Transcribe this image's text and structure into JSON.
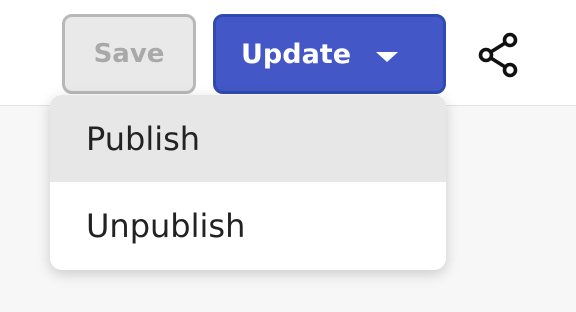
{
  "toolbar": {
    "save_label": "Save",
    "update_label": "Update",
    "share_icon": "share-icon"
  },
  "dropdown": {
    "items": [
      {
        "label": "Publish",
        "highlighted": true
      },
      {
        "label": "Unpublish",
        "highlighted": false
      }
    ]
  },
  "colors": {
    "primary": "#4358c6",
    "primary_border": "#2f4bb3",
    "disabled_bg": "#e9e9e9",
    "disabled_text": "#a9a9a9",
    "hover_bg": "#e7e7e7"
  }
}
